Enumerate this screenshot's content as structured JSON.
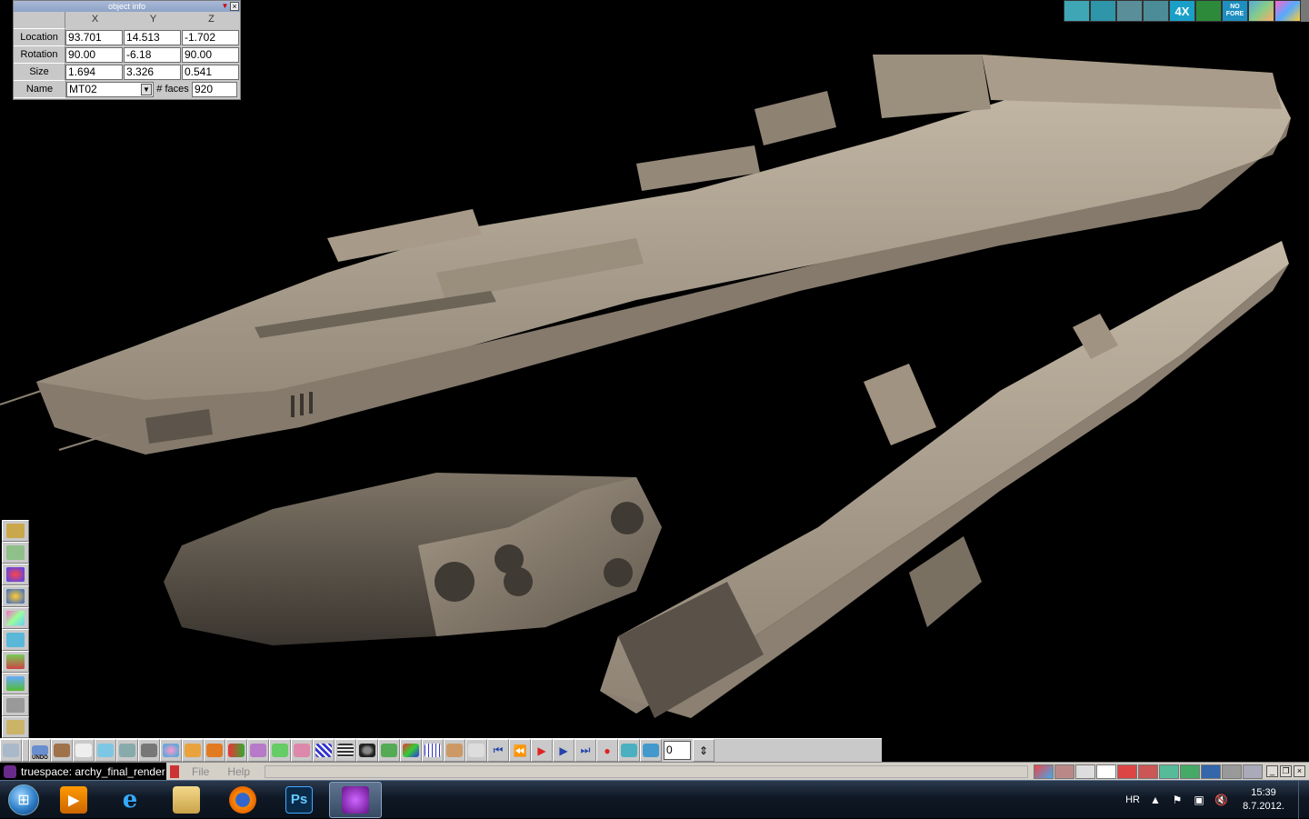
{
  "object_info": {
    "title": "object info",
    "headers": [
      "X",
      "Y",
      "Z"
    ],
    "rows": [
      {
        "label": "Location",
        "x": "93.701",
        "y": "14.513",
        "z": "-1.702"
      },
      {
        "label": "Rotation",
        "x": "90.00",
        "y": "-6.18",
        "z": "90.00"
      },
      {
        "label": "Size",
        "x": "1.694",
        "y": "3.326",
        "z": "0.541"
      }
    ],
    "name_label": "Name",
    "name_value": "MT02",
    "faces_label": "# faces",
    "faces_value": "920"
  },
  "top_tools": {
    "zoom_label": "4X",
    "nofore_label": "NO FORE"
  },
  "bottom_tools": {
    "undo_label": "UNDO",
    "frame_value": "0"
  },
  "app_bar": {
    "title": "truespace: archy_final_render",
    "menu": [
      "File",
      "Help"
    ]
  },
  "taskbar": {
    "ps_label": "Ps",
    "language": "HR",
    "time": "15:39",
    "date": "8.7.2012."
  },
  "colors": {
    "hull": "#b3a592",
    "hull_dark": "#6d6458",
    "viewport_bg": "#000000",
    "taskbar": "#0f1824"
  }
}
